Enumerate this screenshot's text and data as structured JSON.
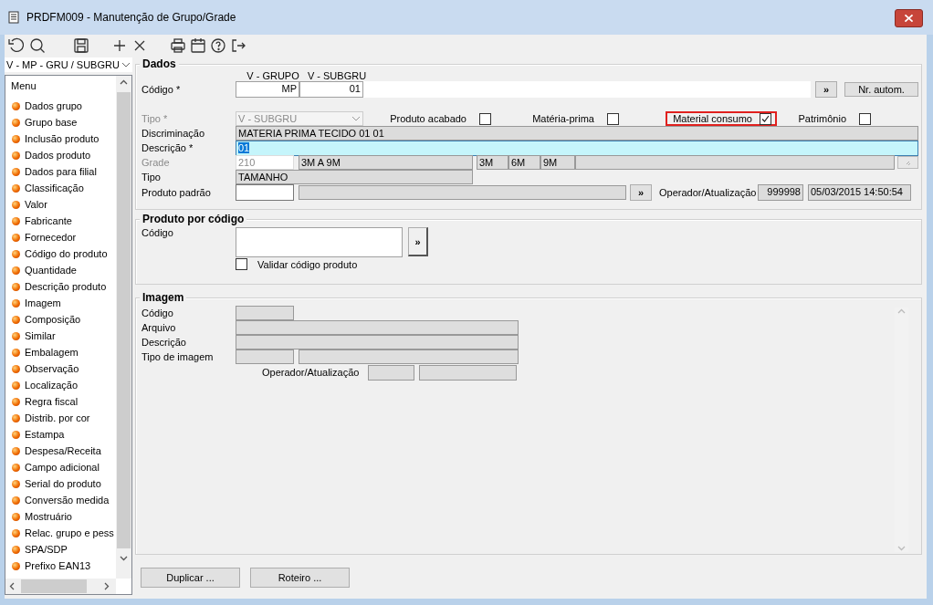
{
  "window": {
    "title": "PRDFM009 - Manutenção de Grupo/Grade"
  },
  "sidebar": {
    "selector": "V - MP - GRU / SUBGRU",
    "menu_title": "Menu",
    "items": [
      "Dados grupo",
      "Grupo base",
      "Inclusão produto",
      "Dados produto",
      "Dados para filial",
      "Classificação",
      "Valor",
      "Fabricante",
      "Fornecedor",
      "Código do produto",
      "Quantidade",
      "Descrição produto",
      "Imagem",
      "Composição",
      "Similar",
      "Embalagem",
      "Observação",
      "Localização",
      "Regra fiscal",
      "Distrib. por cor",
      "Estampa",
      "Despesa/Receita",
      "Campo adicional",
      "Serial do produto",
      "Conversão medida",
      "Mostruário",
      "Relac. grupo e pess",
      "SPA/SDP",
      "Prefixo EAN13"
    ]
  },
  "dados": {
    "title": "Dados",
    "code_columns": [
      "V - GRUPO",
      "V - SUBGRU"
    ],
    "code_label": "Código *",
    "code_values": [
      "MP",
      "01"
    ],
    "more_button": "»",
    "auto_button": "Nr. autom.",
    "tipo": {
      "label": "Tipo *",
      "disabled": true,
      "value": "V - SUBGRU"
    },
    "flags": [
      {
        "label": "Produto acabado",
        "checked": false,
        "highlighted": false
      },
      {
        "label": "Matéria-prima",
        "checked": false,
        "highlighted": false
      },
      {
        "label": "Material consumo",
        "checked": true,
        "highlighted": true
      },
      {
        "label": "Patrimônio",
        "checked": false,
        "highlighted": false
      }
    ],
    "discriminacao": {
      "label": "Discriminação",
      "value": "MATERIA PRIMA TECIDO 01 01"
    },
    "descricao": {
      "label": "Descrição *",
      "value": "01",
      "focused": true
    },
    "grade": {
      "label": "Grade",
      "disabled": true,
      "code": "210",
      "range": "3M A 9M",
      "sizes": [
        "3M",
        "6M",
        "9M"
      ]
    },
    "tipo_grade": {
      "label": "Tipo",
      "value": "TAMANHO"
    },
    "produto_padrao": {
      "label": "Produto padrão",
      "button": "»"
    },
    "operador": {
      "label": "Operador/Atualização",
      "user": "999998",
      "timestamp": "05/03/2015 14:50:54"
    }
  },
  "produto_por_codigo": {
    "title": "Produto por código",
    "code_label": "Código",
    "button": "»",
    "validate": {
      "label": "Validar código produto",
      "checked": false
    }
  },
  "imagem": {
    "title": "Imagem",
    "labels": [
      "Código",
      "Arquivo",
      "Descrição",
      "Tipo de imagem"
    ],
    "operator_label": "Operador/Atualização"
  },
  "buttons": [
    "Duplicar ...",
    "Roteiro ..."
  ]
}
